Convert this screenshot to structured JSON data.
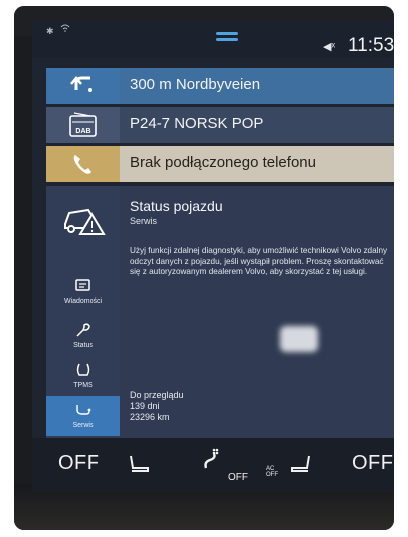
{
  "status_bar": {
    "time": "11:53"
  },
  "tiles": {
    "navigation": {
      "text": "300 m Nordbyveien",
      "icon": "turn-arrow-icon"
    },
    "radio": {
      "text": "P24-7 NORSK POP",
      "icon": "dab-radio-icon",
      "icon_label": "DAB"
    },
    "phone": {
      "text": "Brak podłączonego telefonu",
      "icon": "phone-icon"
    }
  },
  "vehicle_status": {
    "title": "Status pojazdu",
    "subtitle": "Serwis",
    "body": "Użyj funkcji zdalnej diagnostyki, aby umożliwić technikowi Volvo zdalny odczyt danych z pojazdu, jeśli wystąpił problem. Proszę skontaktować się z autoryzowanym dealerem Volvo, aby skorzystać z tej usługi.",
    "due_label": "Do przeglądu",
    "due_days": "139 dni",
    "due_km": "23296 km"
  },
  "sidebar": {
    "items": [
      {
        "label": "Wiadomości",
        "icon": "message-icon",
        "active": false
      },
      {
        "label": "Status",
        "icon": "wrench-icon",
        "active": false
      },
      {
        "label": "TPMS",
        "icon": "tire-pressure-icon",
        "active": false
      },
      {
        "label": "Serwis",
        "icon": "service-icon",
        "active": true
      }
    ]
  },
  "climate": {
    "left_temp": "OFF",
    "right_temp": "OFF",
    "fan": "OFF",
    "ac_top": "AC",
    "ac_bottom": "OFF"
  },
  "colors": {
    "nav_tile": "#3f6f9e",
    "phone_tile": "#cdc6b6",
    "active_tab": "#3b78b8"
  }
}
